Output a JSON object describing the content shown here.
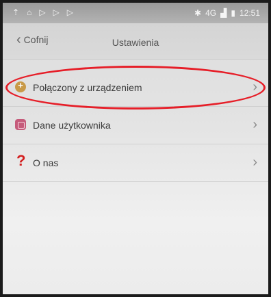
{
  "statusbar": {
    "left_icons": [
      "upload-icon",
      "home-icon",
      "play-icon",
      "play-icon",
      "play-icon"
    ],
    "bluetooth_icon": "bluetooth-icon",
    "network": "4G",
    "time": "12:51"
  },
  "navbar": {
    "back_label": "Cofnij",
    "title": "Ustawienia"
  },
  "settings": {
    "items": [
      {
        "label": "Połączony z urządzeniem",
        "icon": "connected-device-icon",
        "icon_color": "#c99a48"
      },
      {
        "label": "Dane użytkownika",
        "icon": "user-data-icon",
        "icon_color": "#c55a7a"
      },
      {
        "label": "O nas",
        "icon": "question-mark-icon",
        "icon_color": "#d32020"
      }
    ]
  },
  "annotation": {
    "color": "#e61e28"
  }
}
